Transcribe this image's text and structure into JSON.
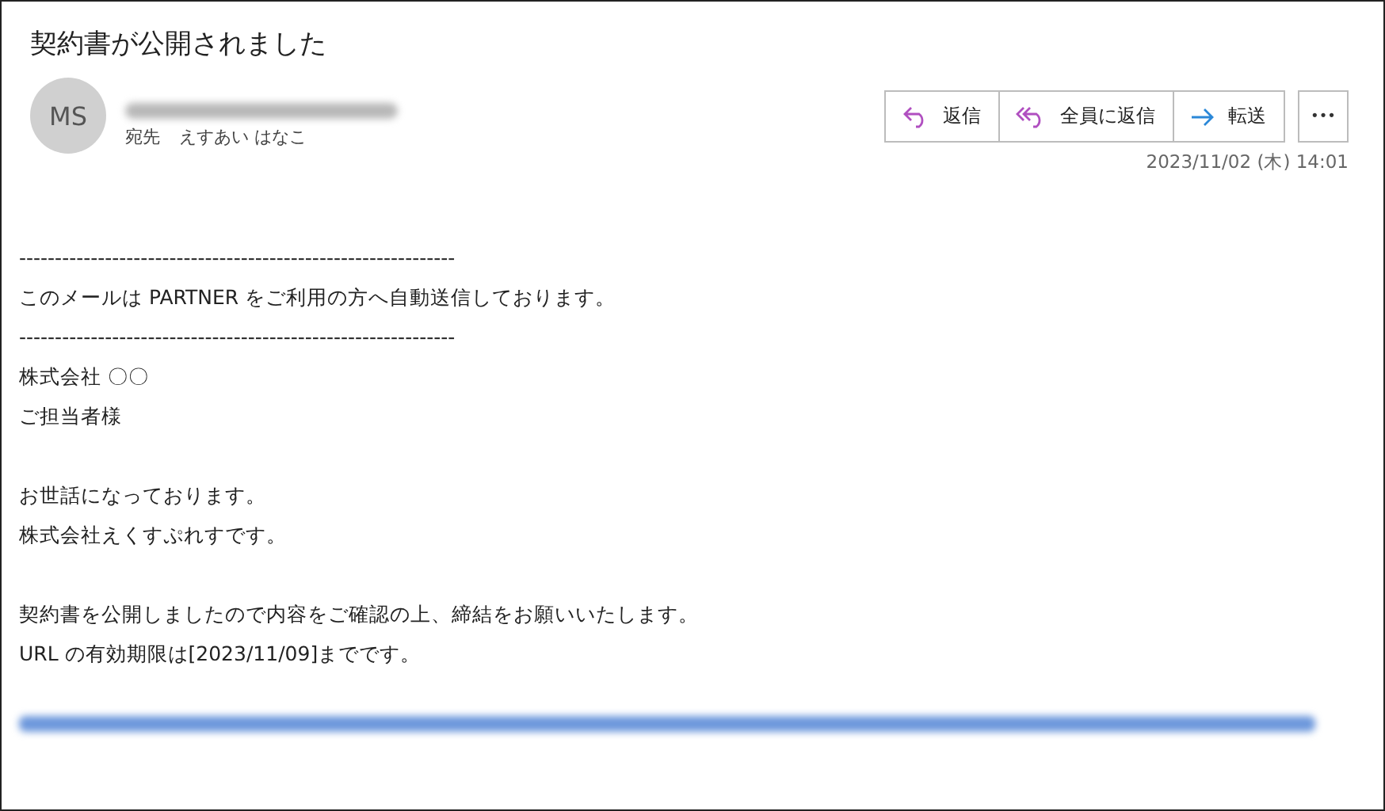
{
  "subject": "契約書が公開されました",
  "sender": {
    "initials": "MS",
    "to_label": "宛先",
    "to_name": "えすあい はなこ"
  },
  "actions": [
    {
      "kind": "reply",
      "label": "返信"
    },
    {
      "kind": "reply_all",
      "label": "全員に返信"
    },
    {
      "kind": "forward",
      "label": "転送"
    }
  ],
  "more": "•••",
  "date": "2023/11/02 (木) 14:01",
  "body": [
    [
      "-------------------------------------------------------------",
      "このメールは PARTNER をご利用の方へ自動送信しております。",
      "-------------------------------------------------------------",
      "株式会社 〇〇",
      "ご担当者様"
    ],
    [
      "お世話になっております。",
      "株式会社えくすぷれすです。"
    ],
    [
      "契約書を公開しましたので内容をご確認の上、締結をお願いいたします。",
      "URL の有効期限は[2023/11/09]までです。"
    ]
  ]
}
